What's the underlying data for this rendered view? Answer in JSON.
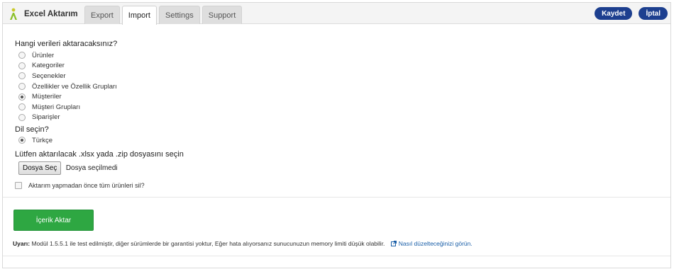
{
  "app": {
    "title": "Excel Aktarım",
    "logo_icon": "excel-export-logo-icon"
  },
  "tabs": [
    {
      "label": "Export",
      "active": false
    },
    {
      "label": "Import",
      "active": true
    },
    {
      "label": "Settings",
      "active": false
    },
    {
      "label": "Support",
      "active": false
    }
  ],
  "actions": {
    "save_label": "Kaydet",
    "cancel_label": "İptal",
    "color": "#1d3f8f"
  },
  "form": {
    "data_question": "Hangi verileri aktaracaksınız?",
    "data_options": [
      {
        "label": "Ürünler",
        "checked": false
      },
      {
        "label": "Kategoriler",
        "checked": false
      },
      {
        "label": "Seçenekler",
        "checked": false
      },
      {
        "label": "Özellikler ve Özellik Grupları",
        "checked": false
      },
      {
        "label": "Müşteriler",
        "checked": true
      },
      {
        "label": "Müşteri Grupları",
        "checked": false
      },
      {
        "label": "Siparişler",
        "checked": false
      }
    ],
    "language_question": "Dil seçin?",
    "language_options": [
      {
        "label": "Türkçe",
        "checked": true
      }
    ],
    "file_prompt": "Lütfen aktarılacak .xlsx yada .zip dosyasını seçin",
    "file_button_label": "Dosya Seç",
    "file_status": "Dosya seçilmedi",
    "delete_checkbox_label": "Aktarım yapmadan önce tüm ürünleri sil?",
    "delete_checked": false
  },
  "submit": {
    "label": "İçerik Aktar",
    "color": "#2ea742"
  },
  "warning": {
    "prefix": "Uyarı:",
    "text": "Modül 1.5.5.1 ile test edilmiştir, diğer sürümlerde bir garantisi yoktur, Eğer hata alıyorsanız sunucunuzun memory limiti düşük olabilir.",
    "link_label": "Nasıl düzelteceğinizi görün.",
    "link_icon": "external-link-icon"
  }
}
